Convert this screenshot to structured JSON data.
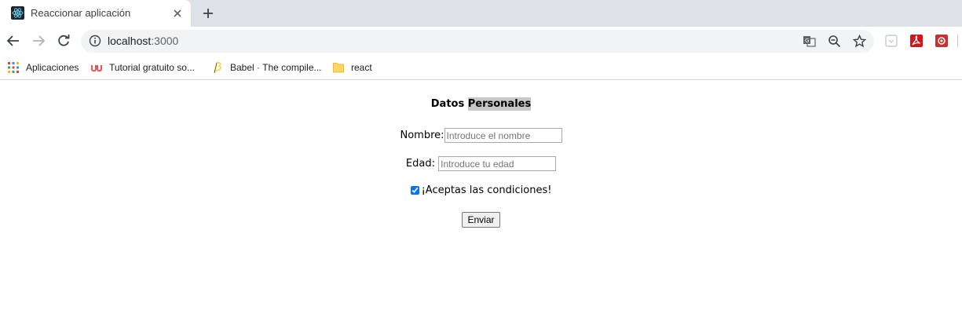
{
  "browser": {
    "tab": {
      "title": "Reaccionar aplicación",
      "favicon": "react-icon"
    },
    "new_tab_icon": "plus-icon",
    "toolbar": {
      "back_icon": "back-arrow-icon",
      "forward_icon": "forward-arrow-icon",
      "reload_icon": "reload-icon",
      "info_icon": "info-icon",
      "url_host": "localhost",
      "url_port": ":3000",
      "translate_icon": "translate-icon",
      "zoom_icon": "zoom-out-icon",
      "star_icon": "bookmark-star-icon",
      "extensions": [
        "extension-icon",
        "adobe-acrobat-icon",
        "extension-red-icon"
      ]
    },
    "bookmarks": [
      {
        "label": "Aplicaciones",
        "icon": "apps-grid-icon"
      },
      {
        "label": "Tutorial gratuito so...",
        "icon": "udemy-icon"
      },
      {
        "label": "Babel · The compile...",
        "icon": "babel-icon"
      },
      {
        "label": "react",
        "icon": "folder-icon"
      }
    ]
  },
  "form": {
    "title_part1": "Datos",
    "title_part2": "Personales",
    "name_label": "Nombre:",
    "name_placeholder": "Introduce el nombre",
    "age_label": "Edad:",
    "age_placeholder": "Introduce tu edad",
    "accept_label": "¡Aceptas las condiciones!",
    "accept_checked": true,
    "submit_label": "Enviar"
  },
  "colors": {
    "tabstrip_bg": "#dee1e6",
    "omnibox_bg": "#f1f3f4",
    "selection_bg": "#c8c8c8"
  }
}
